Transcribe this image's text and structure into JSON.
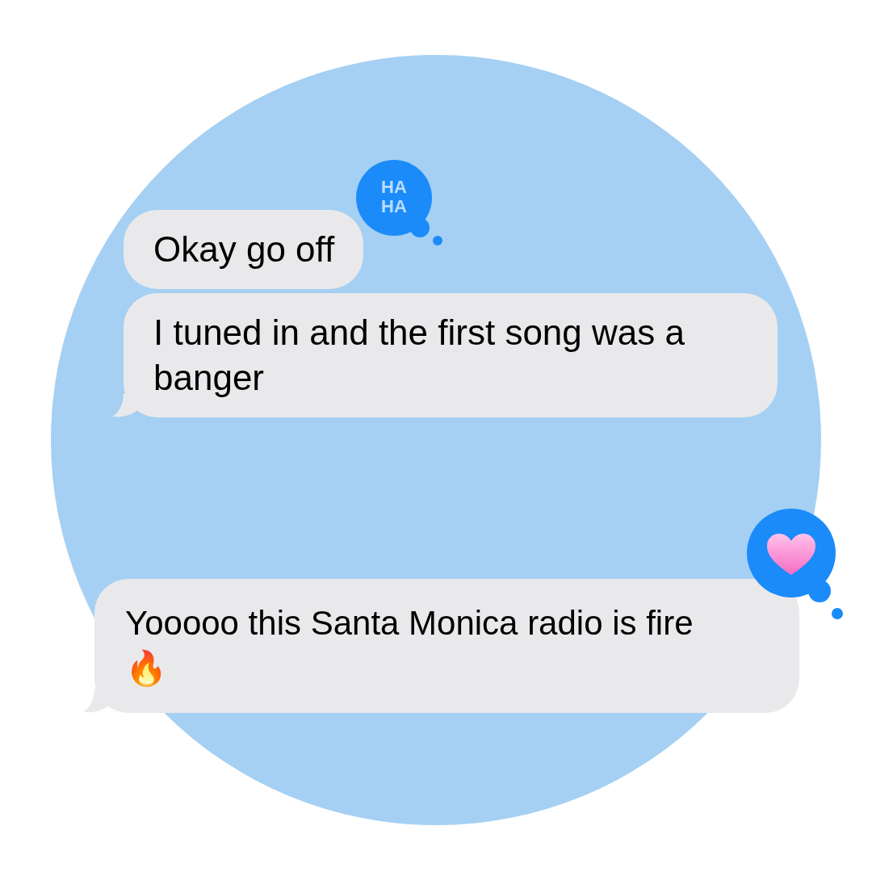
{
  "messages": [
    {
      "text": "Okay go off",
      "tail": false,
      "reaction": {
        "kind": "haha",
        "text": "HA HA"
      }
    },
    {
      "text": "I tuned in and the first song was a banger",
      "tail": true
    },
    {
      "text": "Yooooo this Santa Monica radio is fire 🔥",
      "tail": true,
      "reaction": {
        "kind": "heart"
      }
    }
  ]
}
